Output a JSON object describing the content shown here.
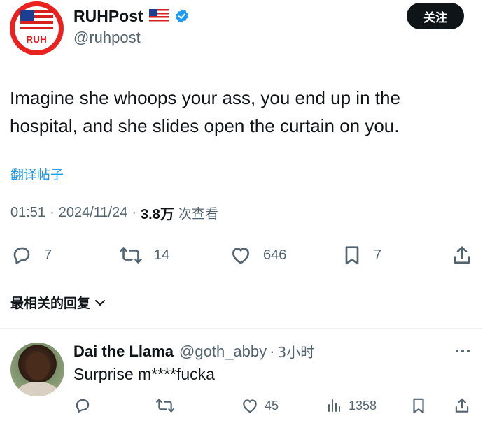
{
  "author": {
    "display_name": "RUHPost",
    "handle": "@ruhpost",
    "avatar_logo_text": "RUH"
  },
  "follow_button_label": "关注",
  "tweet": {
    "text": "Imagine she whoops your ass, you end up in the hospital, and she slides open the curtain on you.",
    "translate_label": "翻译帖子",
    "time": "01:51",
    "date": "2024/11/24",
    "separator": "·",
    "views": "3.8万",
    "views_label": "次查看"
  },
  "actions": {
    "replies": "7",
    "reposts": "14",
    "likes": "646",
    "bookmarks": "7"
  },
  "replies_header_label": "最相关的回复",
  "reply": {
    "display_name": "Dai the Llama",
    "handle": "@goth_abby",
    "separator": "·",
    "time": "3小时",
    "text": "Surprise m****fucka",
    "likes": "45",
    "views": "1358"
  },
  "colors": {
    "accent": "#1d9bf0",
    "text": "#0f1419",
    "muted": "#536471",
    "follow_bg": "#0f1419",
    "logo_red": "#e9221f"
  }
}
